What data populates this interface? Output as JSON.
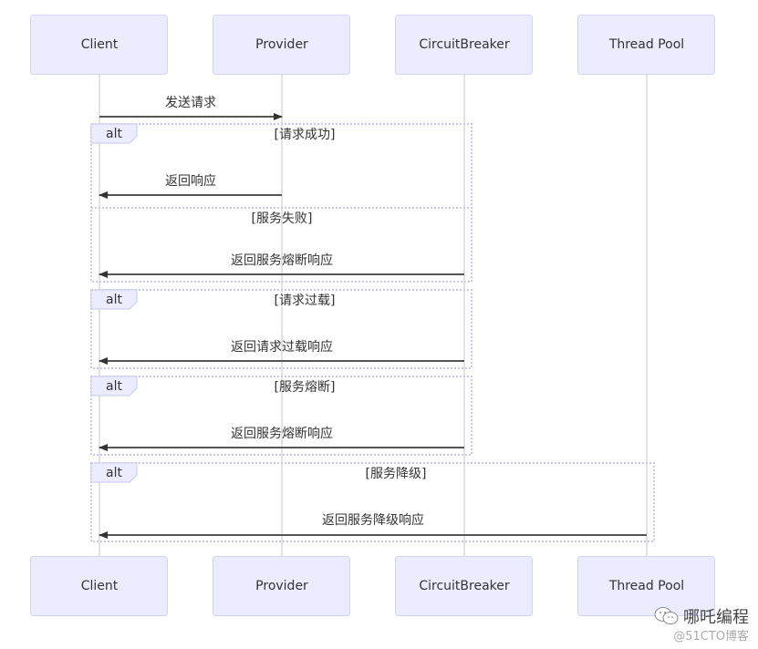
{
  "diagram": {
    "type": "sequence",
    "participants": [
      {
        "id": "client",
        "label": "Client"
      },
      {
        "id": "provider",
        "label": "Provider"
      },
      {
        "id": "circuitbreaker",
        "label": "CircuitBreaker"
      },
      {
        "id": "threadpool",
        "label": "Thread Pool"
      }
    ],
    "messages": [
      {
        "from": "client",
        "to": "provider",
        "label": "发送请求"
      },
      {
        "from": "provider",
        "to": "client",
        "label": "返回响应"
      },
      {
        "from": "circuitbreaker",
        "to": "client",
        "label": "返回服务熔断响应"
      },
      {
        "from": "circuitbreaker",
        "to": "client",
        "label": "返回请求过载响应"
      },
      {
        "from": "circuitbreaker",
        "to": "client",
        "label": "返回服务熔断响应"
      },
      {
        "from": "threadpool",
        "to": "client",
        "label": "返回服务降级响应"
      }
    ],
    "alt_blocks": [
      {
        "tag": "alt",
        "sections": [
          {
            "condition": "[请求成功]"
          },
          {
            "condition": "[服务失败]"
          }
        ]
      },
      {
        "tag": "alt",
        "sections": [
          {
            "condition": "[请求过载]"
          }
        ]
      },
      {
        "tag": "alt",
        "sections": [
          {
            "condition": "[服务熔断]"
          }
        ]
      },
      {
        "tag": "alt",
        "sections": [
          {
            "condition": "[服务降级]"
          }
        ]
      }
    ]
  },
  "watermark": {
    "icon": "wechat-icon",
    "title": "哪吒编程",
    "subtitle": "@51CTO博客"
  }
}
